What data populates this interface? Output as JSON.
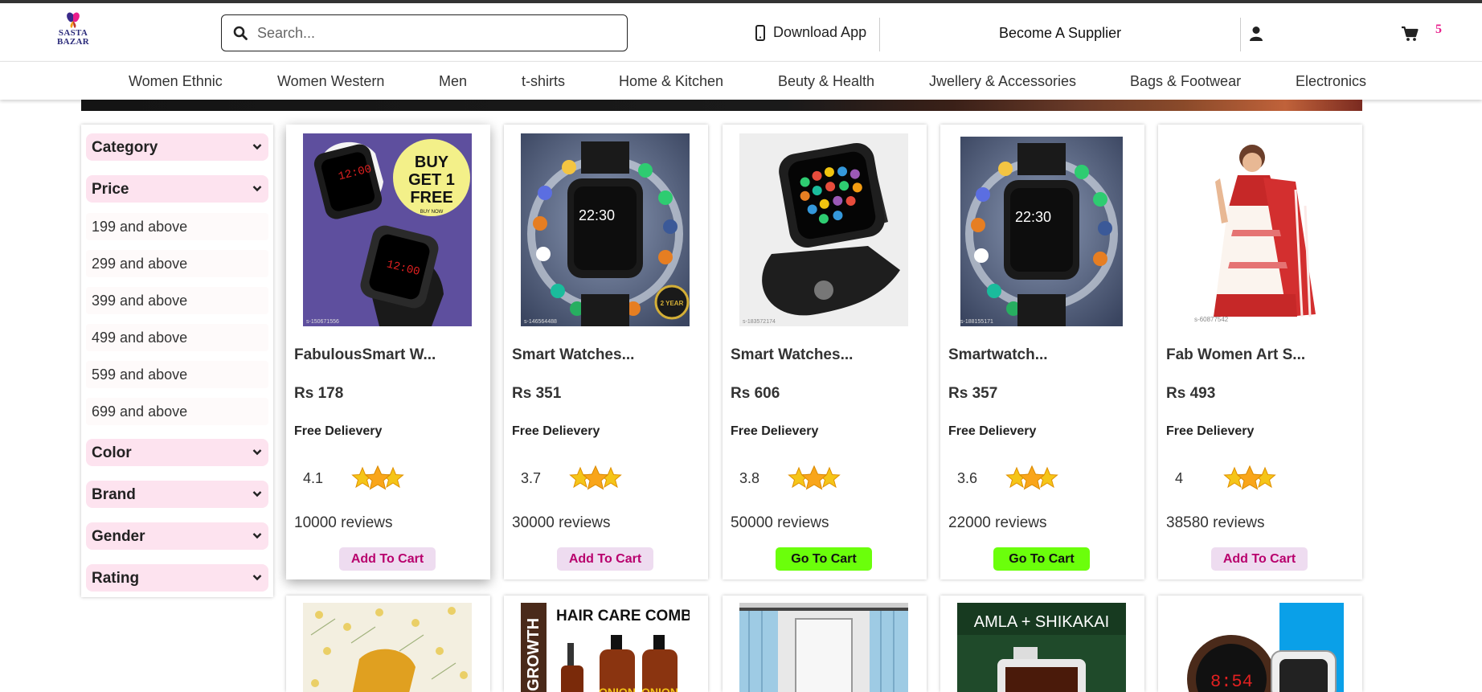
{
  "brand": {
    "line1": "SASTA",
    "line2": "BAZAR"
  },
  "search": {
    "placeholder": "Search..."
  },
  "header": {
    "download_label": "Download App",
    "supplier_label": "Become A Supplier",
    "cart_count": "5"
  },
  "nav": [
    "Women Ethnic",
    "Women Western",
    "Men",
    "t-shirts",
    "Home & Kitchen",
    "Beuty & Health",
    "Jwellery & Accessories",
    "Bags & Footwear",
    "Electronics"
  ],
  "filters": {
    "category": "Category",
    "price": "Price",
    "price_options": [
      "199 and above",
      "299 and above",
      "399 and above",
      "499 and above",
      "599 and above",
      "699 and above"
    ],
    "color": "Color",
    "brand": "Brand",
    "gender": "Gender",
    "rating": "Rating"
  },
  "products": [
    {
      "name": "FabulousSmart W...",
      "price": "Rs 178",
      "delivery": "Free Delievery",
      "rating": "4.1",
      "reviews": "10000 reviews",
      "button": "Add To Cart",
      "in_cart": false
    },
    {
      "name": "Smart Watches...",
      "price": "Rs 351",
      "delivery": "Free Delievery",
      "rating": "3.7",
      "reviews": "30000 reviews",
      "button": "Add To Cart",
      "in_cart": false
    },
    {
      "name": "Smart Watches...",
      "price": "Rs 606",
      "delivery": "Free Delievery",
      "rating": "3.8",
      "reviews": "50000 reviews",
      "button": "Go To Cart",
      "in_cart": true
    },
    {
      "name": "Smartwatch...",
      "price": "Rs 357",
      "delivery": "Free Delievery",
      "rating": "3.6",
      "reviews": "22000 reviews",
      "button": "Go To Cart",
      "in_cart": true
    },
    {
      "name": "Fab Women Art S...",
      "price": "Rs 493",
      "delivery": "Free Delievery",
      "rating": "4",
      "reviews": "38580 reviews",
      "button": "Add To Cart",
      "in_cart": false
    }
  ],
  "images": {
    "p1": {
      "badge_l1": "BUY",
      "badge_l2": "GET 1",
      "badge_l3": "FREE",
      "badge_l4": "BUY NOW",
      "time": "12:00",
      "code": "s-150671556"
    },
    "p2": {
      "time": "22:30",
      "badge": "2 YEAR",
      "code": "s-146564488"
    },
    "p3": {
      "code": "s-183572174"
    },
    "p4": {
      "time": "22:30",
      "code": "s-188155171"
    },
    "p5": {
      "code": "s-60877542"
    }
  },
  "row2_images": {
    "hair_combo": "HAIR CARE COMBO",
    "growth": "GROWTH",
    "onion": "ONION",
    "amla": "AMLA + SHIKAKAI",
    "watch_time": "8:54"
  },
  "colors": {
    "accent_pink": "#e91e8c",
    "filter_bg": "#fde3ef",
    "go_cart": "#6bff0b",
    "add_cart_text": "#b8006d"
  }
}
